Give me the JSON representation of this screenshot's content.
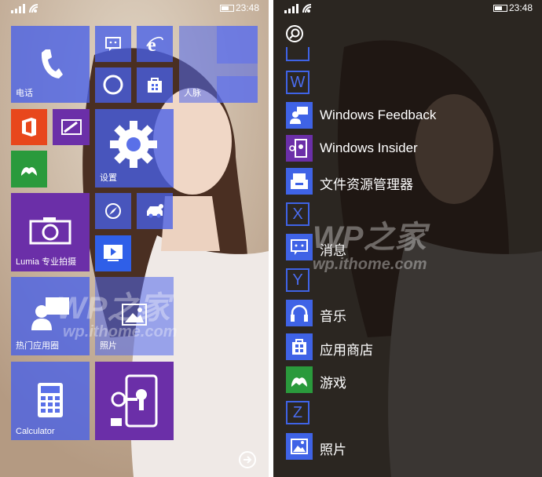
{
  "status": {
    "time": "23:48"
  },
  "start": {
    "tiles": {
      "phone": "电话",
      "people": "人脉",
      "settings": "设置",
      "lumia_camera": "Lumia 专业拍摄",
      "hot_apps": "热门应用圈",
      "photos": "照片",
      "calculator": "Calculator"
    }
  },
  "applist": {
    "letters": {
      "w": "W",
      "x": "X",
      "y": "Y",
      "z": "Z"
    },
    "apps": {
      "windows_feedback": "Windows Feedback",
      "windows_insider": "Windows Insider",
      "file_manager": "文件资源管理器",
      "messaging": "消息",
      "music": "音乐",
      "store": "应用商店",
      "games": "游戏",
      "photos": "照片"
    }
  },
  "watermark": {
    "brand": "WP之家",
    "url": "wp.ithome.com"
  },
  "colors": {
    "accent": "#3f63e6",
    "orange": "#e8471c",
    "purple": "#6b2fa8",
    "green": "#2a9a3c"
  }
}
